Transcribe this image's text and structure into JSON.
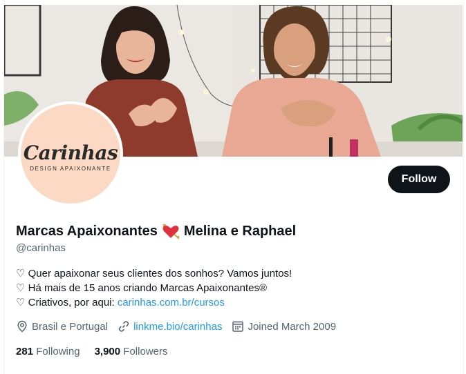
{
  "profile": {
    "display_name_part1": "Marcas Apaixonantes",
    "display_name_part2": "Melina e Raphael",
    "handle": "@carinhas",
    "follow_label": "Follow",
    "avatar_logo": {
      "word": "Carinhas",
      "sub": "DESIGN APAIXONANTE"
    },
    "bio": {
      "line1": "♡ Quer apaixonar seus clientes dos sonhos? Vamos juntos!",
      "line2": "♡ Há mais de 15 anos criando Marcas Apaixonantes®",
      "line3_prefix": "♡ Criativos, por aqui: ",
      "line3_link": "carinhas.com.br/cursos"
    },
    "meta": {
      "location": "Brasil e Portugal",
      "website": "linkme.bio/carinhas",
      "joined": "Joined March 2009"
    },
    "stats": {
      "following_count": "281",
      "following_label": "Following",
      "followers_count": "3,900",
      "followers_label": "Followers"
    }
  },
  "icons": {
    "emoji": "heart-with-arrow-icon",
    "location": "location-pin-icon",
    "website": "link-icon",
    "joined": "calendar-icon"
  },
  "colors": {
    "follow_button": "#0f1419",
    "link": "#1d9bf0",
    "secondary_text": "#536471",
    "avatar_bg": "#fcd9c5"
  }
}
